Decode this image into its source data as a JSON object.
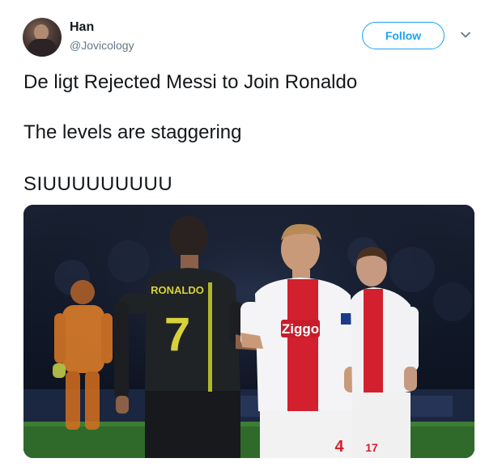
{
  "user": {
    "display_name": "Han",
    "handle": "@Jovicology"
  },
  "actions": {
    "follow_label": "Follow",
    "menu_icon": "chevron-down-icon"
  },
  "tweet": {
    "lines": [
      "De ligt Rejected Messi to Join Ronaldo",
      "The levels are staggering",
      "SIUUUUUUUUU"
    ]
  },
  "photo": {
    "shirt_name": "RONALDO",
    "shirt_number": "7",
    "sponsor": "Ziggo",
    "player_number_left": "4",
    "player_number_right": "17"
  },
  "colors": {
    "accent": "#1da1f2",
    "text": "#14171a",
    "secondary_text": "#657786"
  }
}
